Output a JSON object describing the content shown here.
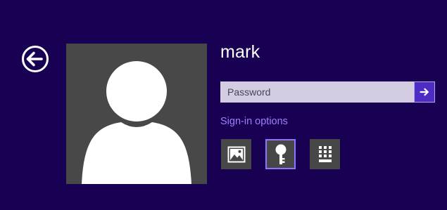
{
  "user": {
    "name": "mark"
  },
  "password": {
    "placeholder": "Password",
    "value": ""
  },
  "signin_options": {
    "label": "Sign-in options",
    "options": [
      {
        "icon": "picture-password-icon",
        "selected": false
      },
      {
        "icon": "key-icon",
        "selected": true
      },
      {
        "icon": "pin-keypad-icon",
        "selected": false
      }
    ]
  },
  "colors": {
    "background": "#180052",
    "accent": "#4e2bc4",
    "link": "#9d80ff",
    "tile": "#474747",
    "input": "#d4cde2"
  }
}
